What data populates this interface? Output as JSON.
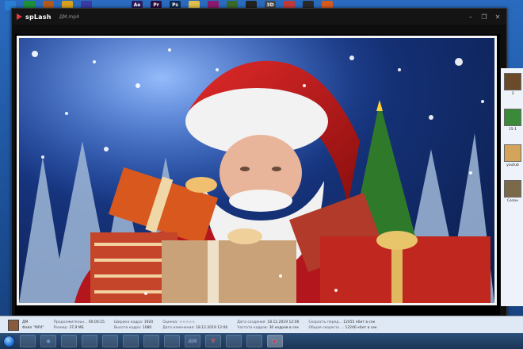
{
  "player": {
    "app_name": "spLash",
    "file_name": "ДМ.mp4",
    "controls": [
      "–",
      "❐",
      "✕"
    ]
  },
  "desktop_icons": [
    {
      "label": "",
      "color": "#2a7fd4"
    },
    {
      "label": "",
      "color": "#1e8f3a"
    },
    {
      "label": "",
      "color": "#b35a1e"
    },
    {
      "label": "",
      "color": "#d6a21e"
    },
    {
      "label": "",
      "color": "#3a3aa3"
    },
    {
      "label": "Ae",
      "color": "#2a1a5e"
    },
    {
      "label": "Pr",
      "color": "#2a0e3e"
    },
    {
      "label": "Ps",
      "color": "#0e2a4e"
    },
    {
      "label": "",
      "color": "#e0c04a"
    },
    {
      "label": "",
      "color": "#8a1a6e"
    },
    {
      "label": "",
      "color": "#3a6a2a"
    },
    {
      "label": "",
      "color": "#222222"
    },
    {
      "label": "3D",
      "color": "#444444"
    },
    {
      "label": "",
      "color": "#c23a3a"
    },
    {
      "label": "",
      "color": "#2a2a2a"
    },
    {
      "label": "",
      "color": "#d65a1e"
    }
  ],
  "side_files": [
    {
      "label": "3",
      "color": "#6b4a2a"
    },
    {
      "label": "15-1",
      "color": "#3b8a3a"
    },
    {
      "label": "youtub",
      "color": "#d4a45a"
    },
    {
      "label": "Сезон",
      "color": "#7a6a4a"
    }
  ],
  "details": {
    "name": "ДМ",
    "type": "Файл \"MP4\"",
    "duration_label": "Продолжительн...",
    "duration_value": "00:00:25",
    "size_label": "Размер:",
    "size_value": "37,9 МБ",
    "width_label": "Ширина кадра:",
    "width_value": "1920",
    "height_label": "Высота кадра:",
    "height_value": "1080",
    "rating_label": "Оценка:",
    "rating_value": "☆☆☆☆☆",
    "modified_label": "Дата изменения:",
    "modified_value": "18.12.2019 12:06",
    "created_label": "Дата создания:",
    "created_value": "18.12.2019 12:06",
    "fps_label": "Частота кадров:",
    "fps_value": "30 кадров в сек",
    "data_rate_label": "Скорость перед...",
    "data_rate_value": "12055 кбит в сек",
    "total_rate_label": "Общая скорость ...",
    "total_rate_value": "12246 кбит в сек"
  },
  "taskbar": {
    "buttons": [
      {
        "name": "explorer",
        "label": "",
        "color": "#d9b44a"
      },
      {
        "name": "ie",
        "label": "e",
        "color": "#3a8ad6"
      },
      {
        "name": "files",
        "label": "",
        "color": "#e0b040"
      },
      {
        "name": "firefox",
        "label": "",
        "color": "#e0722a"
      },
      {
        "name": "media",
        "label": "",
        "color": "#3a6ab5"
      },
      {
        "name": "folder",
        "label": "",
        "color": "#c9a23a"
      },
      {
        "name": "app-red",
        "label": "",
        "color": "#c23a3a"
      },
      {
        "name": "blue-app",
        "label": "",
        "color": "#2a4ab5"
      },
      {
        "name": "am",
        "label": "AM",
        "color": "#4a6aa5"
      },
      {
        "name": "yandex",
        "label": "Y",
        "color": "#d62a2a"
      },
      {
        "name": "torrent",
        "label": "",
        "color": "#3aa53a"
      },
      {
        "name": "chrome",
        "label": "",
        "color": "#3a9a4a"
      },
      {
        "name": "splash",
        "label": "▶",
        "color": "#d62a4a"
      }
    ]
  }
}
